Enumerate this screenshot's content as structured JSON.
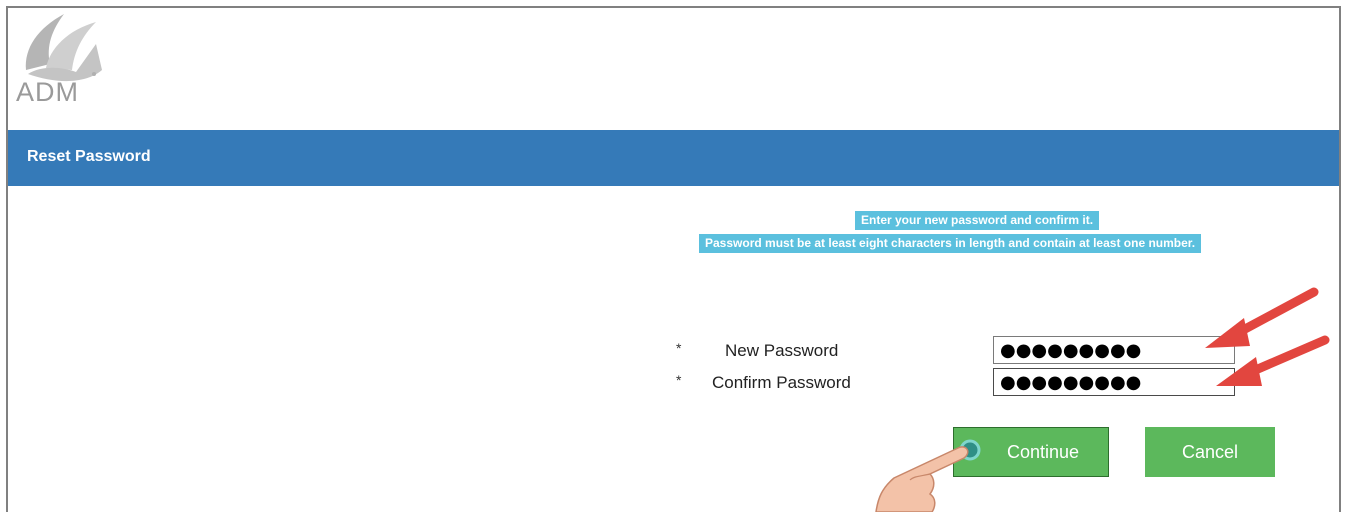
{
  "brand": {
    "name": "ADM",
    "logo_icon": "adm-leaf-logo",
    "color": "#9a9a9a"
  },
  "header": {
    "title": "Reset Password",
    "bg_color": "#357ab8"
  },
  "instructions": {
    "line1": "Enter your new password and confirm it.",
    "line2": "Password must be at least eight characters in length and contain at least one number.",
    "bg_color": "#5bc0de"
  },
  "form": {
    "required_marker": "*",
    "new_password": {
      "label": "New Password",
      "value": "●●●●●●●●●"
    },
    "confirm_password": {
      "label": "Confirm Password",
      "value": "●●●●●●●●●"
    }
  },
  "actions": {
    "continue_label": "Continue",
    "cancel_label": "Cancel",
    "button_color": "#5cb85c"
  },
  "annotations": {
    "arrow_color": "#e2463f",
    "pointer_icon": "hand-pointer-icon"
  }
}
